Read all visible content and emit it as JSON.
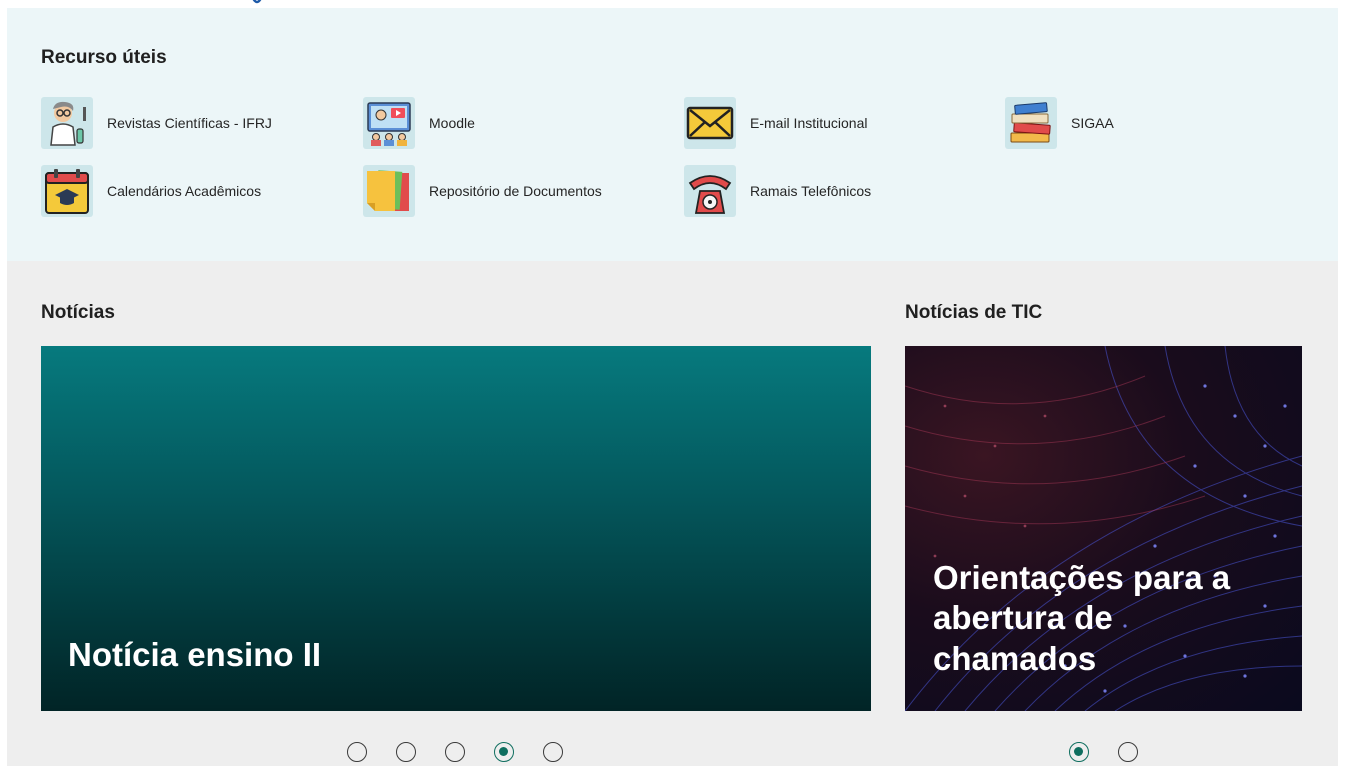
{
  "resources": {
    "title": "Recurso úteis",
    "items": [
      {
        "label": "Revistas Científicas - IFRJ",
        "icon": "scientist-icon"
      },
      {
        "label": "Moodle",
        "icon": "online-class-icon"
      },
      {
        "label": "E-mail Institucional",
        "icon": "envelope-icon"
      },
      {
        "label": "SIGAA",
        "icon": "books-icon"
      },
      {
        "label": "Calendários Acadêmicos",
        "icon": "calendar-graduation-icon"
      },
      {
        "label": "Repositório de Documentos",
        "icon": "documents-icon"
      },
      {
        "label": "Ramais Telefônicos",
        "icon": "telephone-icon"
      }
    ]
  },
  "news": {
    "title": "Notícias",
    "headline": "Notícia ensino II",
    "slide_count": 5,
    "active_slide": 4
  },
  "tic_news": {
    "title": "Notícias de TIC",
    "headline": "Orientações para a abertura de chamados",
    "slide_count": 2,
    "active_slide": 1
  },
  "colors": {
    "resources_bg": "#ecf6f8",
    "page_bg": "#eeeeee",
    "accent": "#0f6e5f",
    "news_card": "#067a7e"
  }
}
